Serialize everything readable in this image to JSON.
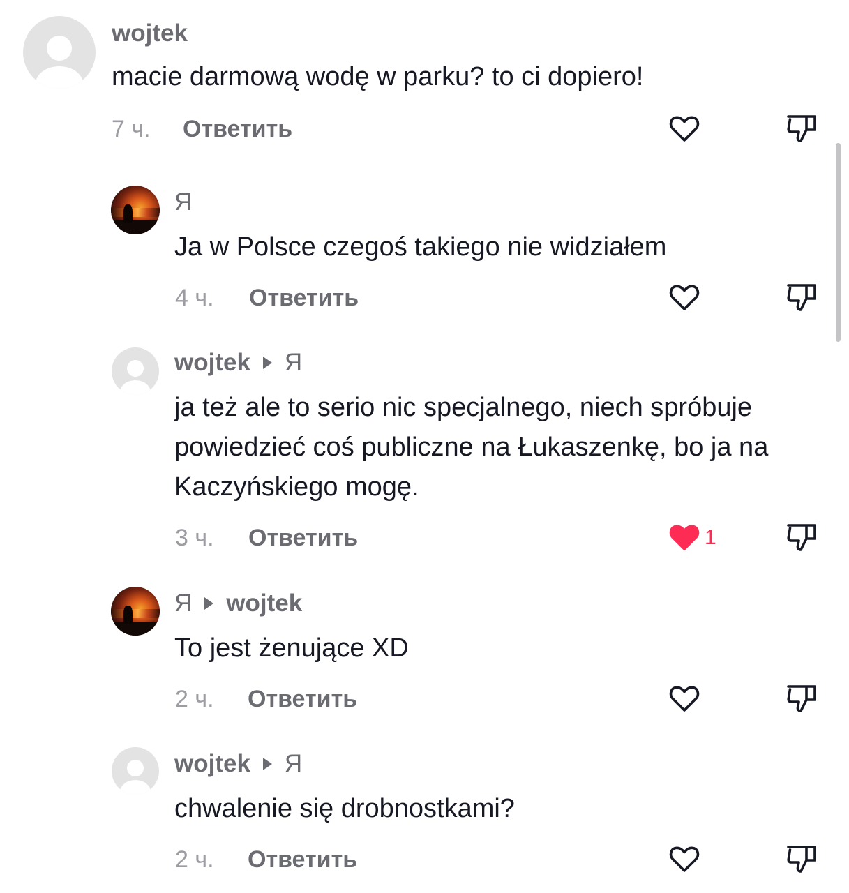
{
  "comments": [
    {
      "author": "wojtek",
      "target": "",
      "text": "macie darmową wodę w parku? to ci dopiero!",
      "time": "7 ч.",
      "reply_label": "Ответить",
      "liked": false,
      "like_count": ""
    },
    {
      "author": "Я",
      "target": "",
      "text": "Ja w Polsce czegoś takiego nie widziałem",
      "time": "4 ч.",
      "reply_label": "Ответить",
      "liked": false,
      "like_count": ""
    },
    {
      "author": "wojtek",
      "target": "Я",
      "text": "ja też ale to serio nic specjalnego, niech spróbuje powiedzieć coś publiczne na Łukaszenkę, bo ja na Kaczyńskiego mogę.",
      "time": "3 ч.",
      "reply_label": "Ответить",
      "liked": true,
      "like_count": "1"
    },
    {
      "author": "Я",
      "target": "wojtek",
      "text": "To jest żenujące XD",
      "time": "2 ч.",
      "reply_label": "Ответить",
      "liked": false,
      "like_count": ""
    },
    {
      "author": "wojtek",
      "target": "Я",
      "text": "chwalenie się drobnostkami?",
      "time": "2 ч.",
      "reply_label": "Ответить",
      "liked": false,
      "like_count": ""
    }
  ],
  "colors": {
    "like_active": "#fe2c55",
    "icon": "#161823",
    "muted_text": "#9c9ca2"
  },
  "icons": {
    "like": "heart-icon",
    "dislike": "thumbs-down-icon",
    "reply_arrow": "caret-right-icon",
    "avatar_default": "default-user-avatar",
    "avatar_photo": "sunset-photo-avatar"
  }
}
